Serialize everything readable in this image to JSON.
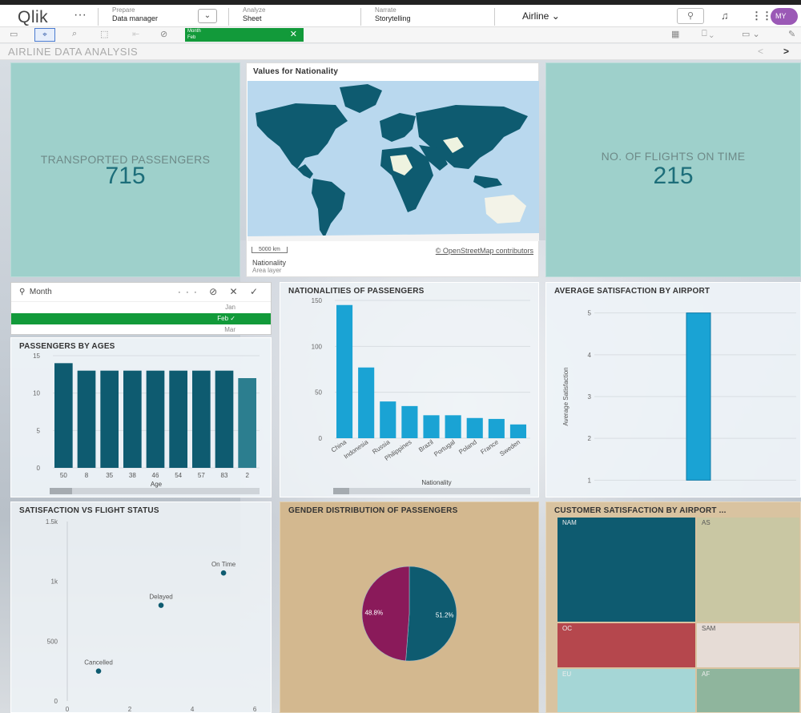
{
  "header": {
    "logo": "Qlik",
    "more": "···",
    "nav": [
      {
        "label": "Prepare",
        "sub": "Data manager"
      },
      {
        "label": "Analyze",
        "sub": "Sheet"
      },
      {
        "label": "Narrate",
        "sub": "Storytelling"
      }
    ],
    "app_name": "Airline",
    "avatar": "MY"
  },
  "toolbar": {
    "selection_field": "Month",
    "selection_value": "Feb"
  },
  "sheet": {
    "title": "AIRLINE DATA ANALYSIS",
    "prev": "<",
    "next": ">"
  },
  "kpi_passengers": {
    "label": "TRANSPORTED PASSENGERS",
    "value": "715"
  },
  "kpi_flights": {
    "label": "NO. OF FLIGHTS ON TIME",
    "value": "215"
  },
  "map": {
    "title": "Values for Nationality",
    "credit": "© OpenStreetMap contributors",
    "scale": "5000 km",
    "layer_name": "Nationality",
    "layer_type": "Area layer",
    "land_color": "#0e5b70",
    "water_color": "#b9d8ee"
  },
  "month_filter": {
    "title": "Month",
    "items": [
      {
        "label": "Jan",
        "selected": false
      },
      {
        "label": "Feb",
        "selected": true
      },
      {
        "label": "Mar",
        "selected": false
      }
    ]
  },
  "colors": {
    "teal_dark": "#0e5b70",
    "blue_bar": "#1aa3d4",
    "magenta": "#8a1a5a",
    "kpi_bg": "#9ed0cb",
    "selection_green": "#129a3a"
  },
  "chart_data": [
    {
      "type": "bar",
      "title": "PASSENGERS BY AGES",
      "xlabel": "Age",
      "ylabel": "",
      "categories": [
        "50",
        "8",
        "35",
        "38",
        "46",
        "54",
        "57",
        "83",
        "2"
      ],
      "values": [
        14,
        13,
        13,
        13,
        13,
        13,
        13,
        13,
        12
      ],
      "ylim": [
        0,
        15
      ],
      "yticks": [
        0,
        5,
        10,
        15
      ]
    },
    {
      "type": "bar",
      "title": "NATIONALITIES OF PASSENGERS",
      "xlabel": "Nationality",
      "ylabel": "",
      "categories": [
        "China",
        "Indonesia",
        "Russia",
        "Philippines",
        "Brazil",
        "Portugal",
        "Poland",
        "France",
        "Sweden"
      ],
      "values": [
        145,
        77,
        40,
        35,
        25,
        25,
        22,
        21,
        15
      ],
      "ylim": [
        0,
        150
      ],
      "yticks": [
        0,
        50,
        100,
        150
      ]
    },
    {
      "type": "bar",
      "title": "AVERAGE SATISFACTION BY AIRPORT",
      "xlabel": "",
      "ylabel": "Average Satisfaction",
      "categories": [
        ""
      ],
      "values": [
        5
      ],
      "ylim": [
        0.7,
        5.3
      ],
      "yticks": [
        1,
        2,
        3,
        4,
        5
      ]
    },
    {
      "type": "scatter",
      "title": "SATISFACTION VS FLIGHT STATUS",
      "points": [
        {
          "label": "Cancelled",
          "x": 1,
          "y": 250
        },
        {
          "label": "Delayed",
          "x": 3,
          "y": 800
        },
        {
          "label": "On Time",
          "x": 5,
          "y": 1070
        }
      ],
      "xlim": [
        0,
        6.1
      ],
      "ylim": [
        0,
        1500
      ],
      "xticks": [
        0,
        2,
        4,
        6
      ],
      "yticks": [
        {
          "v": 0,
          "l": "0"
        },
        {
          "v": 500,
          "l": "500"
        },
        {
          "v": 1000,
          "l": "1k"
        },
        {
          "v": 1500,
          "l": "1.5k"
        }
      ]
    },
    {
      "type": "pie",
      "title": "GENDER DISTRIBUTION OF PASSENGERS",
      "slices": [
        {
          "value": 51.2,
          "label": "51.2%",
          "color": "#0e5b70"
        },
        {
          "value": 48.8,
          "label": "48.8%",
          "color": "#8a1a5a"
        }
      ]
    },
    {
      "type": "treemap",
      "title": "CUSTOMER SATISFACTION BY AIRPORT ...",
      "cells": [
        {
          "label": "NAM",
          "color": "#0e5b70"
        },
        {
          "label": "AS",
          "color": "#c9c7a3"
        },
        {
          "label": "OC",
          "color": "#b5474d"
        },
        {
          "label": "SAM",
          "color": "#e6dcd6"
        },
        {
          "label": "EU",
          "color": "#a5d6d6"
        },
        {
          "label": "AF",
          "color": "#8fb59d"
        }
      ]
    }
  ]
}
